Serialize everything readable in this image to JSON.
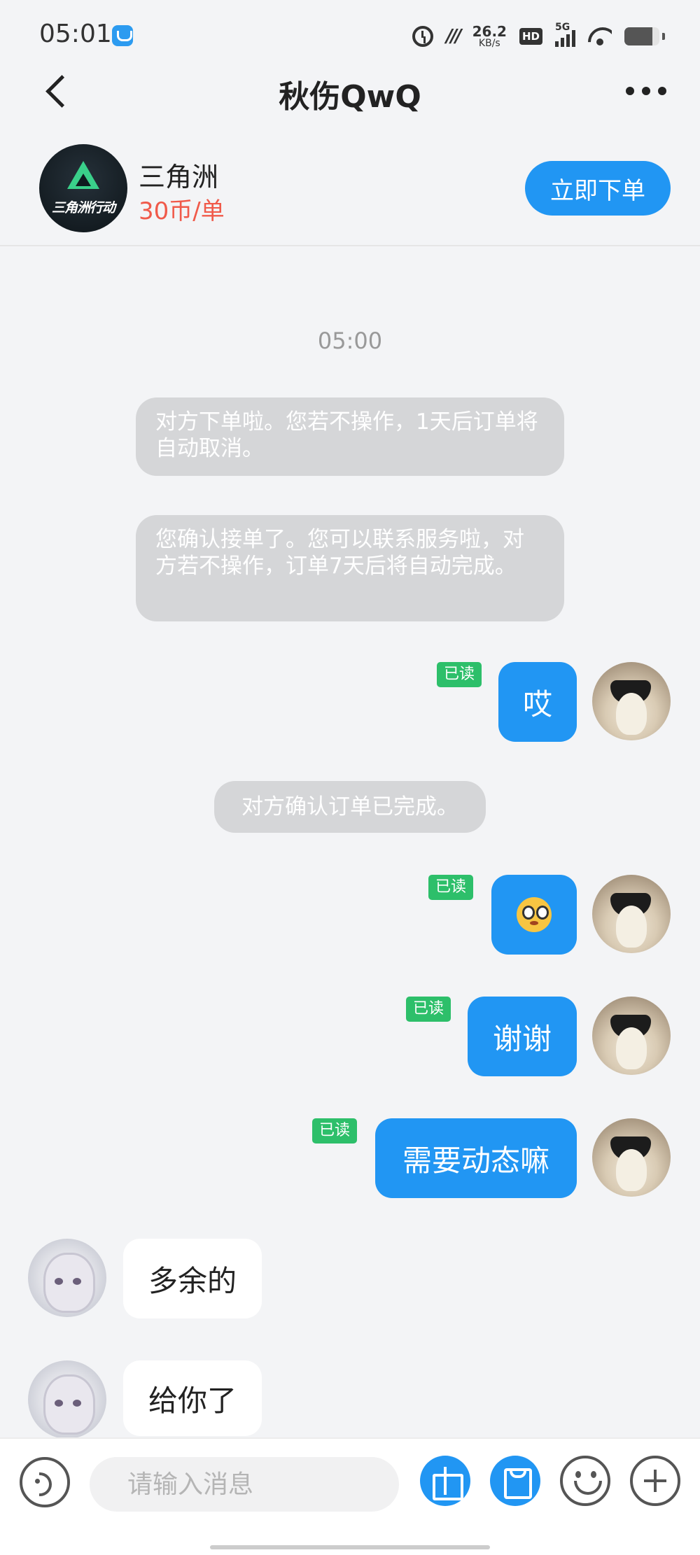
{
  "status_bar": {
    "time": "05:01",
    "network_speed": "26.2",
    "network_speed_unit": "KB/s",
    "hd_badge": "HD",
    "signal_label": "5G",
    "battery_level": 0.8
  },
  "header": {
    "title": "秋伤QwQ"
  },
  "product": {
    "logo_text": "三角洲行动",
    "name": "三角洲",
    "price": "30币/单",
    "order_button": "立即下单"
  },
  "chat": {
    "timestamp": "05:00",
    "system_messages": [
      "对方下单啦。您若不操作，1天后订单将自动取消。",
      "您确认接单了。您可以联系服务啦，对方若不操作，订单7天后将自动完成。",
      "对方确认订单已完成。"
    ],
    "my_messages": [
      {
        "text": "哎",
        "status": "已读"
      },
      {
        "text": "",
        "emoji": "flushed-face",
        "status": "已读"
      },
      {
        "text": "谢谢",
        "status": "已读"
      },
      {
        "text": "需要动态嘛",
        "status": "已读"
      }
    ],
    "other_messages": [
      {
        "text": "多余的"
      },
      {
        "text": "给你了"
      }
    ]
  },
  "input": {
    "placeholder": "请输入消息"
  },
  "colors": {
    "accent": "#2196f3",
    "read_badge": "#2dbf6a",
    "price": "#f05a4a",
    "system_bubble": "#d5d6d8"
  }
}
